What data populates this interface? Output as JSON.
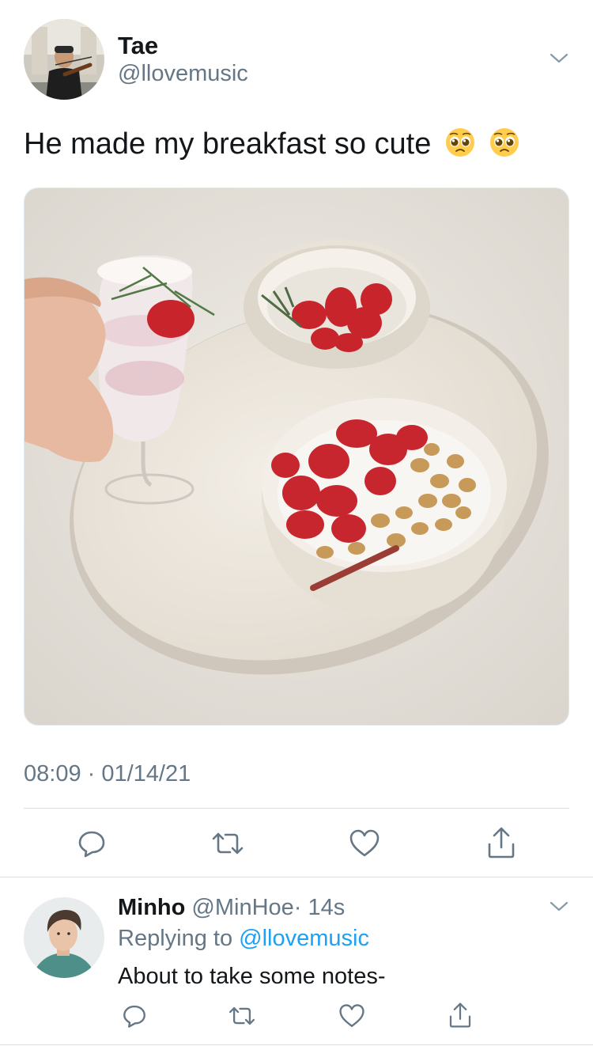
{
  "tweet": {
    "author_name": "Tae",
    "author_handle": "@llovemusic",
    "text": "He made my breakfast so cute",
    "emojis": [
      "pleading-face",
      "pleading-face"
    ],
    "timestamp": "08:09 · 01/14/21",
    "actions": [
      "reply",
      "retweet",
      "like",
      "share"
    ]
  },
  "reply": {
    "author_name": "Minho",
    "author_handle": "@MinHoe",
    "time": "· 14s",
    "replying_prefix": "Replying to",
    "replying_handle": "@llovemusic",
    "text": "About to take some notes-"
  },
  "colors": {
    "text": "#14171a",
    "secondary": "#657786",
    "link": "#1da1f2",
    "divider": "#d9dfe3"
  }
}
